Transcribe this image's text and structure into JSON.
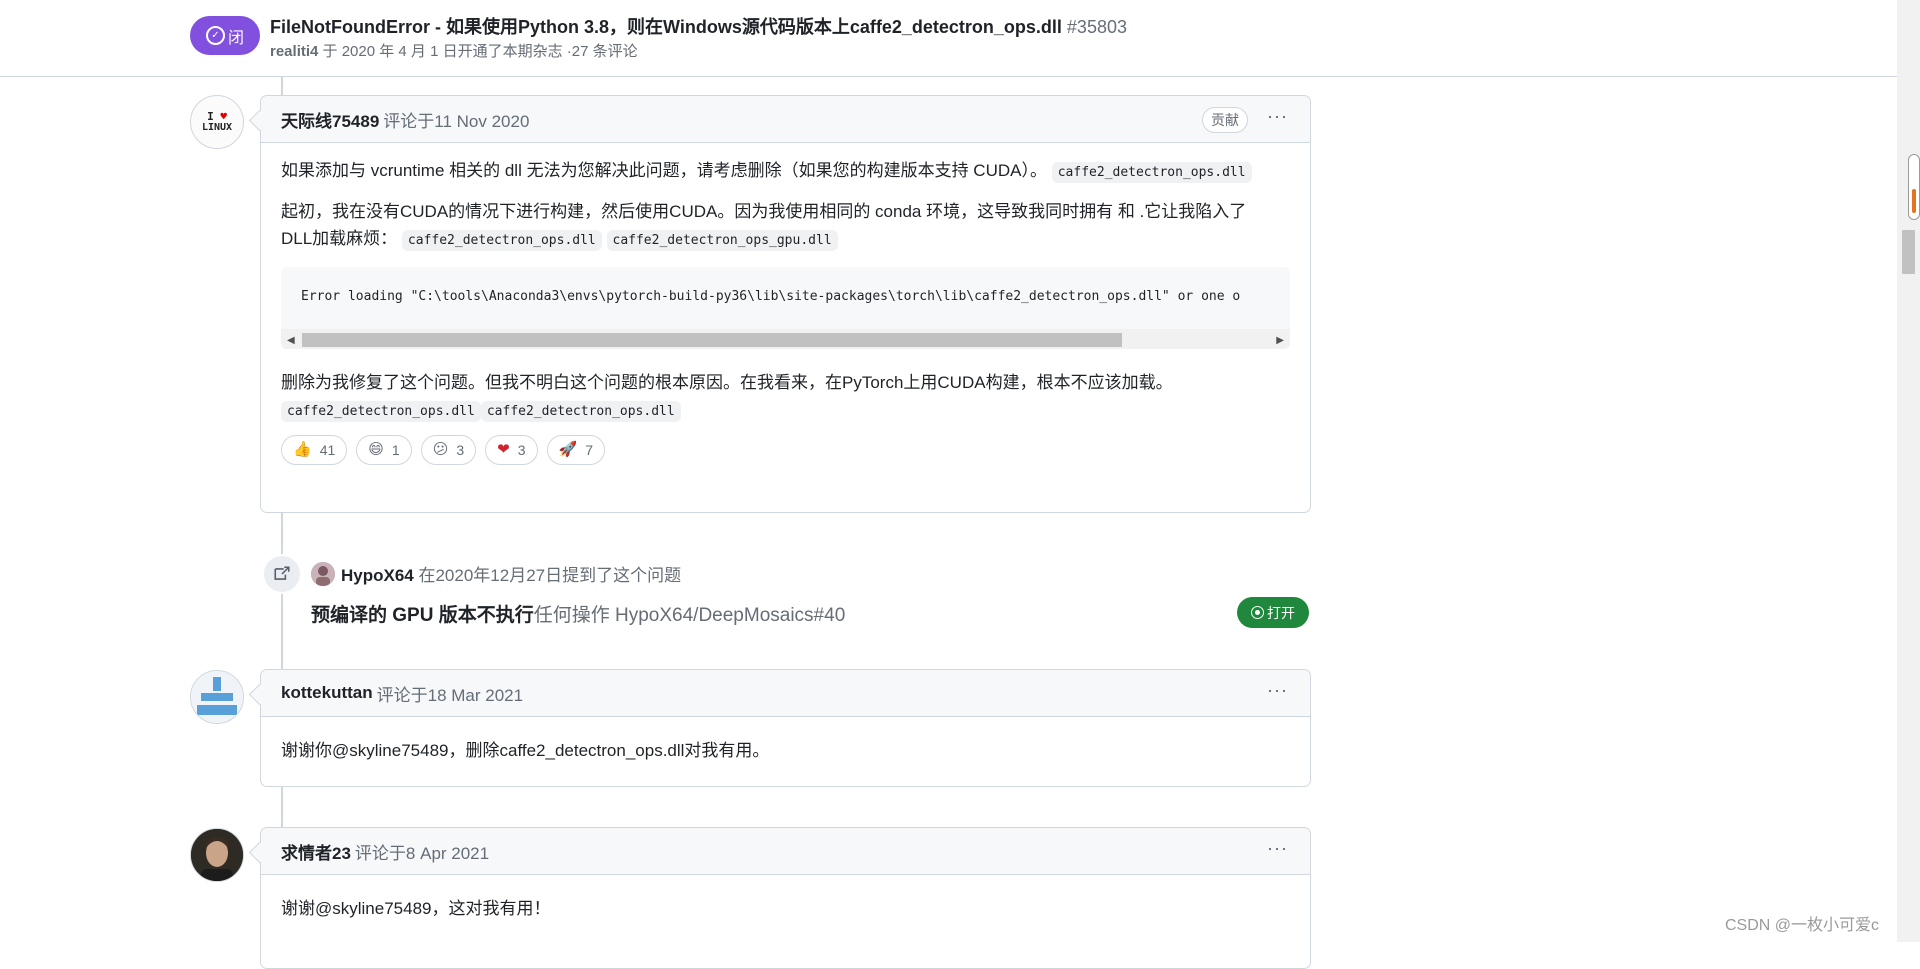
{
  "header": {
    "state": "闭",
    "title": "FileNotFoundError - 如果使用Python 3.8，则在Windows源代码版本上caffe2_detectron_ops.dll",
    "issue_number": "#35803",
    "author": "realiti4",
    "subtitle_rest": " 于 2020 年 4 月 1 日开通了本期杂志 ·27 条评论"
  },
  "comments": [
    {
      "author": "天际线75489",
      "when": "评论于11 Nov 2020",
      "role": "贡献",
      "more": "···",
      "avatar_text_top": "I ♥",
      "avatar_text_bottom": "LINUX",
      "p1_text": "如果添加与 vcruntime 相关的 dll 无法为您解决此问题，请考虑删除（如果您的构建版本支持 CUDA）。",
      "p1_code": "caffe2_detectron_ops.dll",
      "p2_text_a": "起初，我在没有CUDA的情况下进行构建，然后使用CUDA。因为我使用相同的 conda 环境，这导致我同时拥有 和 .它让我陷入了",
      "p2_text_b": "DLL加载麻烦：",
      "p2_code1": "caffe2_detectron_ops.dll",
      "p2_code2": "caffe2_detectron_ops_gpu.dll",
      "code_block": "Error loading \"C:\\tools\\Anaconda3\\envs\\pytorch-build-py36\\lib\\site-packages\\torch\\lib\\caffe2_detectron_ops.dll\" or one o",
      "p3_text": "删除为我修复了这个问题。但我不明白这个问题的根本原因。在我看来，在PyTorch上用CUDA构建，根本不应该加载。",
      "p3_code1": "caffe2_detectron_ops.dll",
      "p3_code2": "caffe2_detectron_ops.dll",
      "reactions": [
        {
          "emoji": "👍",
          "count": "41"
        },
        {
          "emoji": "😄",
          "count": "1"
        },
        {
          "emoji": "😕",
          "count": "3"
        },
        {
          "emoji": "❤",
          "count": "3"
        },
        {
          "emoji": "🚀",
          "count": "7"
        }
      ]
    },
    {
      "author": "kottekuttan",
      "when": "评论于18 Mar 2021",
      "more": "···",
      "body": "谢谢你@skyline75489，删除caffe2_detectron_ops.dll对我有用。"
    },
    {
      "author": "求情者23",
      "when": "评论于8 Apr 2021",
      "more": "···",
      "body": "谢谢@skyline75489，这对我有用！"
    }
  ],
  "reference": {
    "user": "HypoX64",
    "action": " 在2020年12月27日提到了这个问题",
    "title": "预编译的 GPU 版本不执行",
    "repo_ref": "任何操作 HypoX64/DeepMosaics#40",
    "state": "打开"
  },
  "watermark": "CSDN @一枚小可爱c",
  "colors": {
    "closed": "#8250df",
    "open": "#1f883d",
    "border": "#d0d7de",
    "muted": "#656d76"
  }
}
